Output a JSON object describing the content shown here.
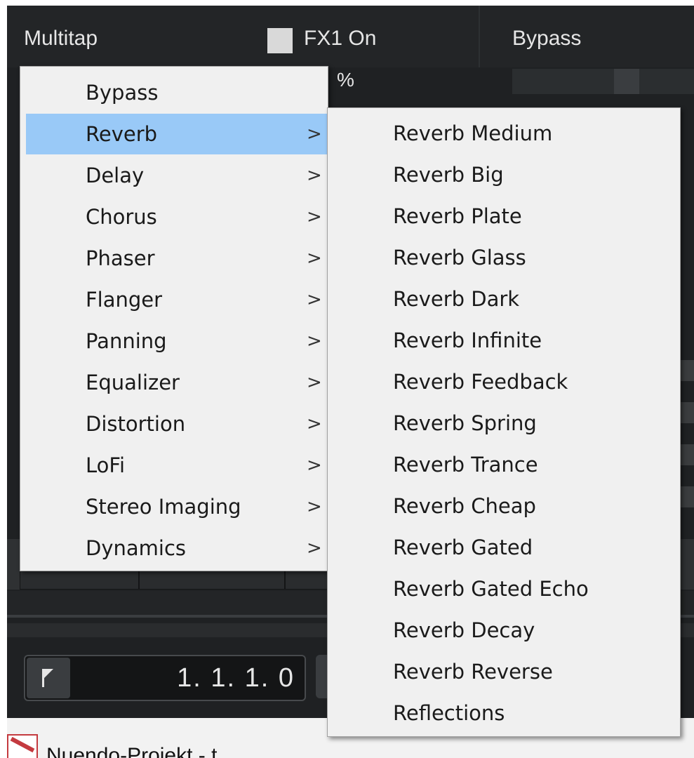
{
  "header": {
    "preset_label": "Multitap",
    "fx_toggle_label": "FX1 On",
    "bypass_label": "Bypass",
    "percent_suffix": "%"
  },
  "transport": {
    "position": "1. 1. 1.   0"
  },
  "project_tab": {
    "name": "Nuendo-Projekt - t"
  },
  "effect_menu": {
    "items": [
      {
        "label": "Bypass",
        "submenu": false
      },
      {
        "label": "Reverb",
        "submenu": true,
        "highlighted": true
      },
      {
        "label": "Delay",
        "submenu": true
      },
      {
        "label": "Chorus",
        "submenu": true
      },
      {
        "label": "Phaser",
        "submenu": true
      },
      {
        "label": "Flanger",
        "submenu": true
      },
      {
        "label": "Panning",
        "submenu": true
      },
      {
        "label": "Equalizer",
        "submenu": true
      },
      {
        "label": "Distortion",
        "submenu": true
      },
      {
        "label": "LoFi",
        "submenu": true
      },
      {
        "label": "Stereo Imaging",
        "submenu": true
      },
      {
        "label": "Dynamics",
        "submenu": true
      }
    ],
    "arrow_glyph": ">"
  },
  "reverb_submenu": {
    "items": [
      "Reverb Medium",
      "Reverb Big",
      "Reverb Plate",
      "Reverb Glass",
      "Reverb Dark",
      "Reverb Infinite",
      "Reverb Feedback",
      "Reverb Spring",
      "Reverb Trance",
      "Reverb Cheap",
      "Reverb Gated",
      "Reverb Gated Echo",
      "Reverb Decay",
      "Reverb Reverse",
      "Reflections"
    ]
  },
  "colors": {
    "highlight": "#99c9f7",
    "menu_bg": "#f0f0f0",
    "app_bg": "#1f2123"
  }
}
